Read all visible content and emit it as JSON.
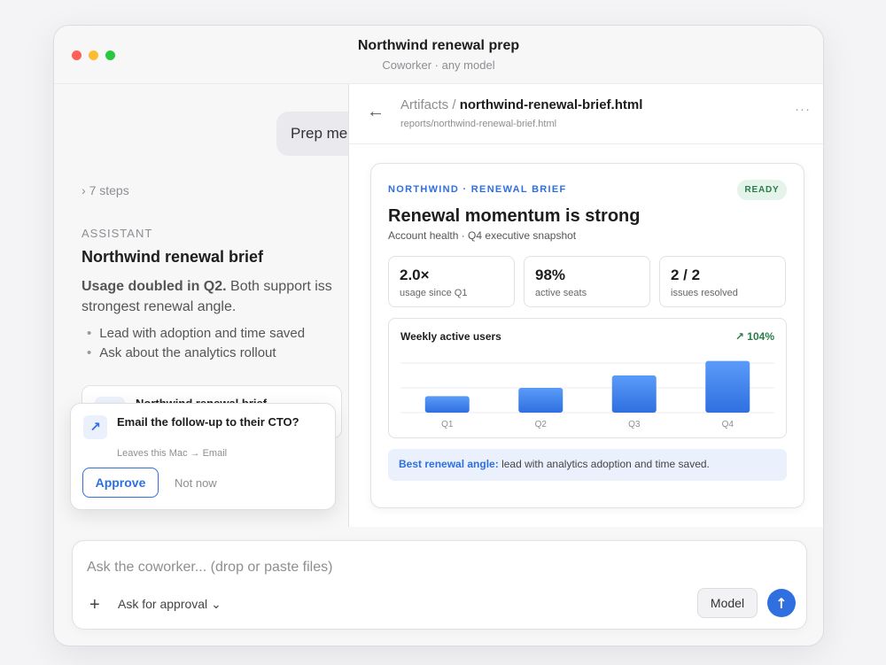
{
  "window": {
    "title": "Northwind renewal prep",
    "subtitle": "Coworker · any model"
  },
  "chat": {
    "user_message": "Prep me",
    "steps_label": "7 steps",
    "assistant_label": "ASSISTANT",
    "brief_title": "Northwind renewal brief",
    "brief_bold": "Usage doubled in Q2.",
    "brief_text": "Both support iss",
    "brief_text2": "strongest renewal angle.",
    "bullets": [
      "Lead with adoption and time saved",
      "Ask about the analytics rollout"
    ],
    "file_card_title": "Northwind renewal brief"
  },
  "approval": {
    "question": "Email the follow-up to their CTO?",
    "meta": "Leaves this Mac → Email",
    "approve_label": "Approve",
    "later_label": "Not now"
  },
  "panel": {
    "crumb_root": "Artifacts",
    "crumb_sep": "/",
    "file_name": "northwind-renewal-brief.html",
    "file_path": "reports/northwind-renewal-brief.html",
    "more": "···"
  },
  "artifact": {
    "eyebrow": "NORTHWIND · RENEWAL BRIEF",
    "status": "READY",
    "title": "Renewal momentum is strong",
    "subtitle": "Account health · Q4 executive snapshot",
    "stats": [
      {
        "value": "2.0×",
        "label": "usage since Q1"
      },
      {
        "value": "98%",
        "label": "active seats"
      },
      {
        "value": "2 / 2",
        "label": "issues resolved"
      }
    ],
    "angle_bold": "Best renewal angle:",
    "angle_text": "lead with analytics adoption and time saved."
  },
  "chart_data": {
    "type": "bar",
    "title": "Weekly active users",
    "annotation": "↗ 104%",
    "categories": [
      "Q1",
      "Q2",
      "Q3",
      "Q4"
    ],
    "values": [
      0.32,
      0.48,
      0.72,
      1.0
    ],
    "ylim": [
      0,
      1.2
    ],
    "grid": true,
    "color_top": "#5a9bf9",
    "color_bottom": "#2f6fe0"
  },
  "composer": {
    "placeholder": "Ask the coworker... (drop or paste files)",
    "plus": "+",
    "approval_mode": "Ask for approval ⌄",
    "model_label": "Model",
    "send": "↑"
  },
  "colors": {
    "accent": "#2f6fe0",
    "success": "#2a7d49"
  }
}
